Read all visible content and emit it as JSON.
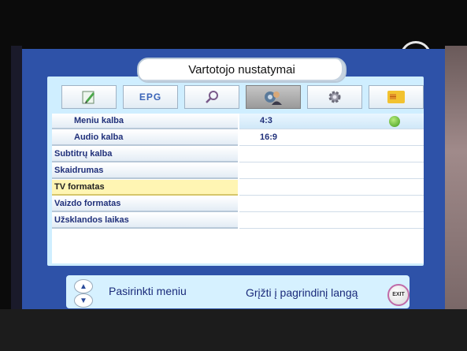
{
  "title": "Vartotojo nustatymai",
  "tabs": [
    {
      "name": "edit-icon"
    },
    {
      "label": "EPG"
    },
    {
      "name": "search-icon"
    },
    {
      "name": "user-settings-icon",
      "active": true
    },
    {
      "name": "gear-icon"
    },
    {
      "name": "smartcard-icon"
    }
  ],
  "menu": {
    "items": [
      {
        "label": "Meniu kalba",
        "value": "4:3",
        "selected": true
      },
      {
        "label": "Audio kalba",
        "value": "16:9"
      },
      {
        "label": "Subtitrų kalba",
        "value": ""
      },
      {
        "label": "Skaidrumas",
        "value": ""
      },
      {
        "label": "TV formatas",
        "value": "",
        "highlighted": true
      },
      {
        "label": "Vaizdo formatas",
        "value": ""
      },
      {
        "label": "Užsklandos laikas",
        "value": ""
      }
    ]
  },
  "footer": {
    "select_hint": "Pasirinkti meniu",
    "back_hint": "Grįžti į pagrindinį langą",
    "exit_label": "EXIT"
  },
  "colors": {
    "frame": "#2e52a8",
    "panel": "#cfeeff",
    "highlight": "#fff5b3",
    "text": "#20307a"
  }
}
